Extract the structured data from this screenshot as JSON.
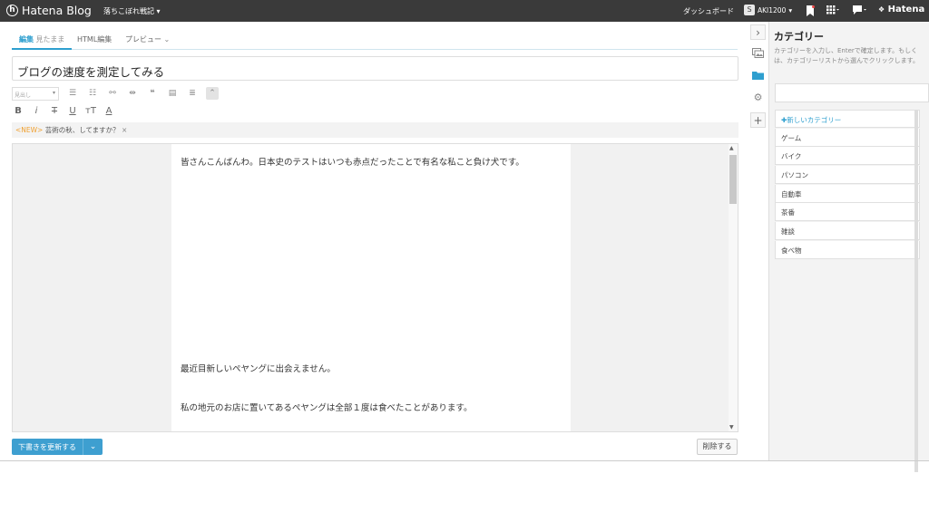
{
  "topbar": {
    "logo_text": "Hatena Blog",
    "logo_mark": "h",
    "blog_name": "落ちこぼれ戦記",
    "blog_dropdown": "▾",
    "dashboard": "ダッシュボード",
    "user_name": "AKI1200",
    "user_dropdown": "▾",
    "avatar_letter": "S",
    "hatena_text": "Hatena",
    "icons": {
      "bookmark": "bookmark-icon",
      "apps": "grid-icon",
      "chat": "chat-icon"
    }
  },
  "editor": {
    "tabs": [
      {
        "label": "編集",
        "sub": "見たまま"
      },
      {
        "label": "HTML編集"
      },
      {
        "label": "プレビュー",
        "chevron": "⌄"
      }
    ],
    "title": "ブログの速度を測定してみる",
    "heading_select": "見出し",
    "notice_new": "<NEW>",
    "notice_text": "芸術の秋、してますか？",
    "notice_close": "×",
    "body_p1": "皆さんこんばんわ。日本史のテストはいつも赤点だったことで有名な私こと負け犬です。",
    "body_p2": "最近目新しいペヤングに出会えません。",
    "body_p3": "私の地元のお店に置いてあるペヤングは全部１度は食べたことがあります。",
    "save_button": "下書きを更新する",
    "save_chevron": "⌄",
    "delete_button": "削除する"
  },
  "categories": {
    "title": "カテゴリー",
    "description": "カテゴリーを入力し、Enterで確定します。もしくは、カテゴリーリストから選んでクリックします。",
    "new_category": "✚新しいカテゴリー",
    "items": [
      "ゲーム",
      "バイク",
      "パソコン",
      "自動車",
      "茶番",
      "雑談",
      "食べ物"
    ]
  },
  "colors": {
    "accent": "#2e9fcf",
    "topbar": "#3a3a3a",
    "new_badge": "#f0a030"
  }
}
